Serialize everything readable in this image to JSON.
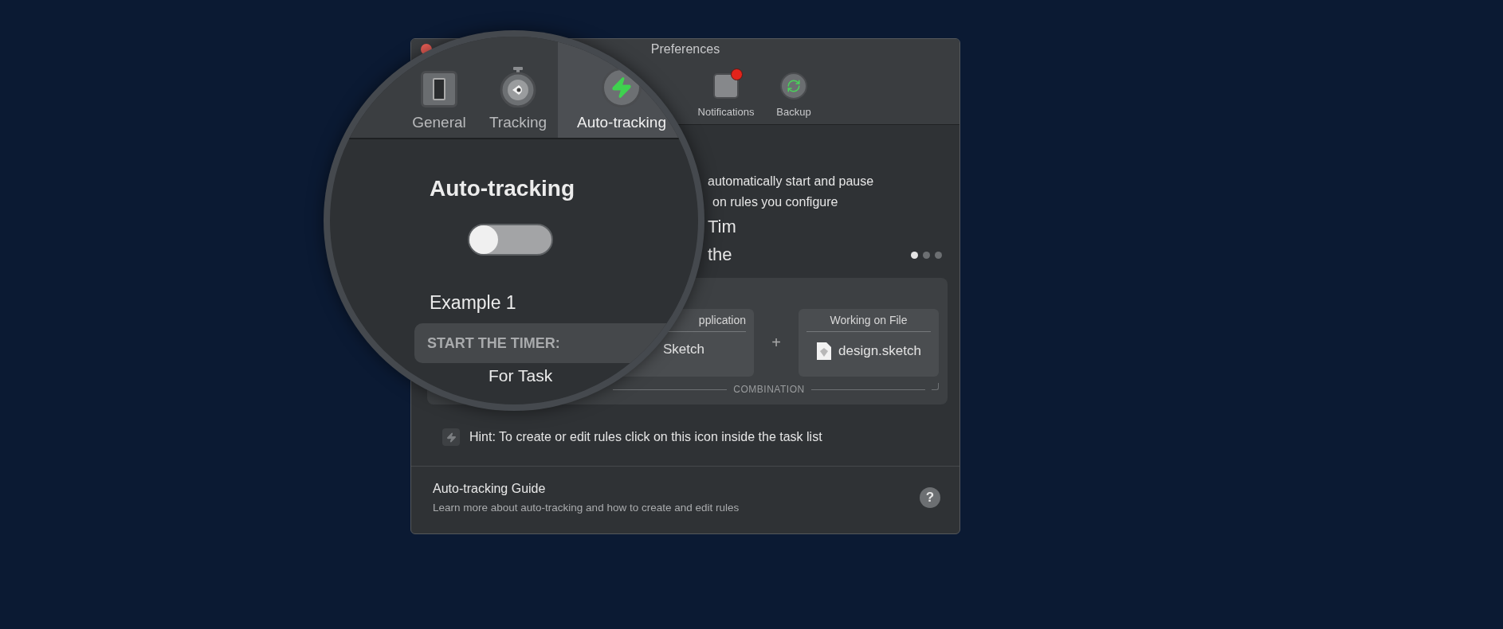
{
  "window": {
    "title": "Preferences"
  },
  "toolbar": [
    {
      "label": "Notifications",
      "badge": true
    },
    {
      "label": "Backup",
      "badge": false
    }
  ],
  "magnifier": {
    "tabs": [
      {
        "label": "General",
        "selected": false
      },
      {
        "label": "Tracking",
        "selected": false
      },
      {
        "label": "Auto-tracking",
        "selected": true
      }
    ],
    "heading": "Auto-tracking",
    "toggle": {
      "on": false
    },
    "example_title": "Example 1",
    "section_label": "START THE TIMER:",
    "task_label": "For Task"
  },
  "description": [
    "automatically start and pause",
    "on rules you configure"
  ],
  "teaser": [
    "Tim",
    "the"
  ],
  "pager": [
    {
      "selected": true
    },
    {
      "selected": false
    },
    {
      "selected": false
    }
  ],
  "example": {
    "conditions": [
      {
        "kind": "app",
        "title": "pplication",
        "value": "Sketch"
      },
      {
        "kind": "file",
        "title": "Working on File",
        "value": "design.sketch"
      }
    ],
    "joiner": "+",
    "combination": "COMBINATION"
  },
  "hint": "Hint: To create or edit rules click on this icon inside the task list",
  "guide": {
    "title": "Auto-tracking Guide",
    "subtitle": "Learn more about auto-tracking and how to create and edit rules",
    "help": "?"
  }
}
